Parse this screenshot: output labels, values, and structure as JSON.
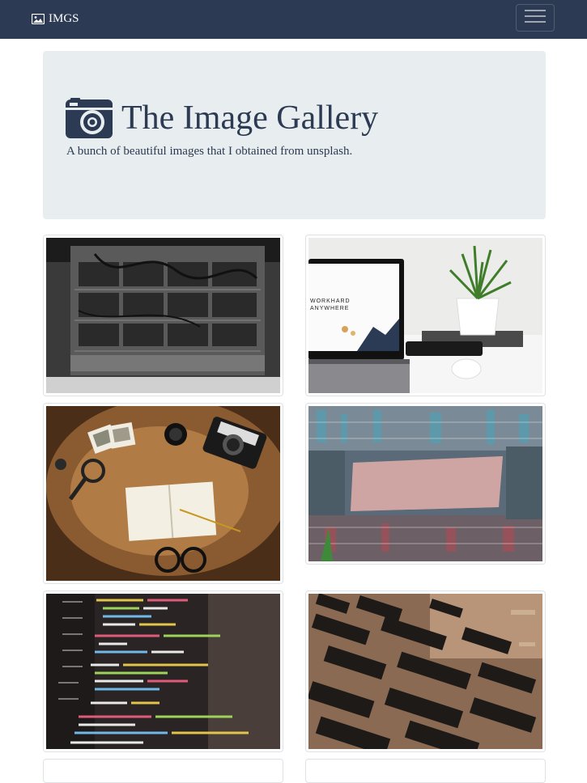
{
  "navbar": {
    "brand_label": "IMGS",
    "brand_icon": "image-icon",
    "toggler_icon": "hamburger-icon",
    "background": "#2c3a53"
  },
  "jumbotron": {
    "title": "The Image Gallery",
    "title_icon": "camera-icon",
    "subtitle": "A bunch of beautiful images that I obtained from unsplash.",
    "background": "#e8eeef"
  },
  "gallery": {
    "images": [
      {
        "name": "server-rack-photo",
        "subject": "black and white server rack"
      },
      {
        "name": "laptop-desk-photo",
        "subject": "laptop with plant on desk",
        "screen_text": [
          "WORKHARD",
          "ANYWHERE"
        ]
      },
      {
        "name": "travel-camera-photo",
        "subject": "map, camera, notebook, glasses"
      },
      {
        "name": "city-buildings-photo",
        "subject": "looking up at dense apartment buildings"
      },
      {
        "name": "code-screen-photo",
        "subject": "code on a screen"
      },
      {
        "name": "circuit-board-photo",
        "subject": "circuit board chips close-up"
      }
    ]
  }
}
